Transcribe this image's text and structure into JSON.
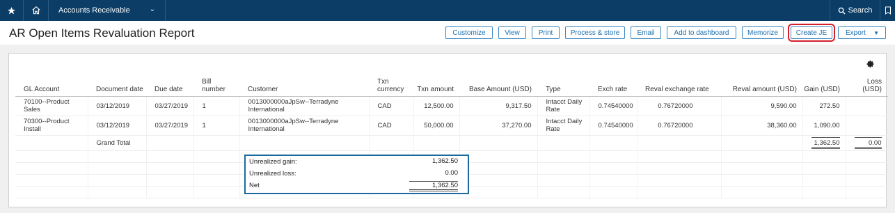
{
  "topbar": {
    "star_icon": "star-icon",
    "home_icon": "home-icon",
    "app_name": "Accounts Receivable",
    "search_label": "Search"
  },
  "page": {
    "title": "AR Open Items Revaluation Report"
  },
  "toolbar": {
    "customize": "Customize",
    "view": "View",
    "print": "Print",
    "process_store": "Process & store",
    "email": "Email",
    "add_dashboard": "Add to dashboard",
    "memorize": "Memorize",
    "create_je": "Create JE",
    "export": "Export"
  },
  "table": {
    "headers": {
      "gl_account": "GL Account",
      "document_date": "Document date",
      "due_date": "Due date",
      "bill_number": "Bill number",
      "customer": "Customer",
      "txn_currency": "Txn currency",
      "txn_amount": "Txn amount",
      "base_amount": "Base Amount (USD)",
      "type": "Type",
      "exch_rate": "Exch rate",
      "reval_exchange_rate": "Reval exchange rate",
      "reval_amount": "Reval amount (USD)",
      "gain": "Gain (USD)",
      "loss": "Loss (USD)"
    },
    "rows": [
      {
        "gl_account": "70100--Product Sales",
        "document_date": "03/12/2019",
        "due_date": "03/27/2019",
        "bill_number": "1",
        "customer": "0013000000aJpSw--Terradyne International",
        "txn_currency": "CAD",
        "txn_amount": "12,500.00",
        "base_amount": "9,317.50",
        "type": "Intacct Daily Rate",
        "exch_rate": "0.74540000",
        "reval_exchange_rate": "0.76720000",
        "reval_amount": "9,590.00",
        "gain": "272.50",
        "loss": ""
      },
      {
        "gl_account": "70300--Product Install",
        "document_date": "03/12/2019",
        "due_date": "03/27/2019",
        "bill_number": "1",
        "customer": "0013000000aJpSw--Terradyne International",
        "txn_currency": "CAD",
        "txn_amount": "50,000.00",
        "base_amount": "37,270.00",
        "type": "Intacct Daily Rate",
        "exch_rate": "0.74540000",
        "reval_exchange_rate": "0.76720000",
        "reval_amount": "38,360.00",
        "gain": "1,090.00",
        "loss": ""
      }
    ],
    "grand_total": {
      "label": "Grand Total",
      "gain": "1,362.50",
      "loss": "0.00"
    }
  },
  "summary": {
    "unrealized_gain_label": "Unrealized gain:",
    "unrealized_gain_value": "1,362.50",
    "unrealized_loss_label": "Unrealized loss:",
    "unrealized_loss_value": "0.00",
    "net_label": "Net",
    "net_value": "1,362.50"
  },
  "colors": {
    "topbar": "#0b3d66",
    "button_border": "#3d87c0",
    "button_text": "#1a6fae",
    "highlight_outline": "#d41f2a",
    "summary_border": "#1a6aa0"
  }
}
